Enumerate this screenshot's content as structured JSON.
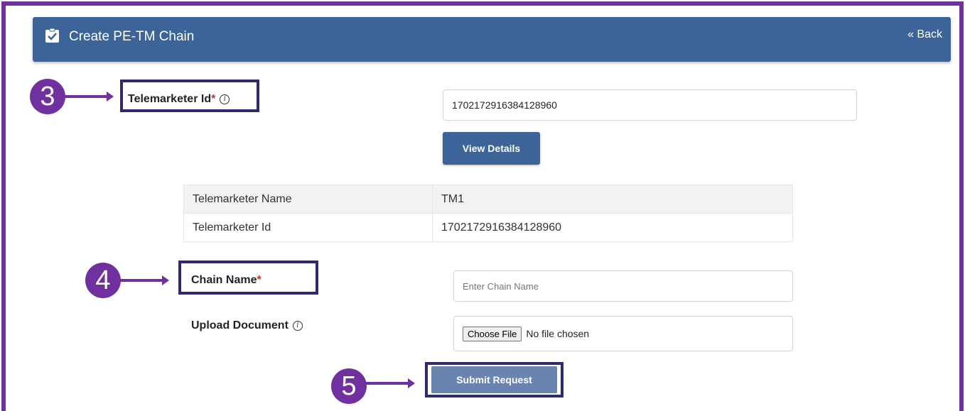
{
  "header": {
    "title": "Create PE-TM Chain",
    "back_label": "« Back",
    "icon": "clipboard-check-icon"
  },
  "telemarketer_id": {
    "label": "Telemarketer Id",
    "required_mark": "*",
    "value": "1702172916384128960",
    "view_details_label": "View Details"
  },
  "details_table": {
    "rows": [
      {
        "key": "Telemarketer Name",
        "value": "TM1"
      },
      {
        "key": "Telemarketer Id",
        "value": "1702172916384128960"
      }
    ]
  },
  "chain_name": {
    "label": "Chain Name",
    "required_mark": "*",
    "placeholder": "Enter Chain Name"
  },
  "upload_document": {
    "label": "Upload Document",
    "choose_file_label": "Choose File",
    "file_status": "No file chosen"
  },
  "submit": {
    "label": "Submit Request"
  },
  "annotations": {
    "step_3": "3",
    "step_4": "4",
    "step_5": "5"
  },
  "colors": {
    "annotation_purple": "#7030a0",
    "highlight_navy": "#2e2a6e",
    "header_blue": "#3c6498",
    "submit_blue": "#6984ae",
    "required_red": "#c0392b"
  }
}
